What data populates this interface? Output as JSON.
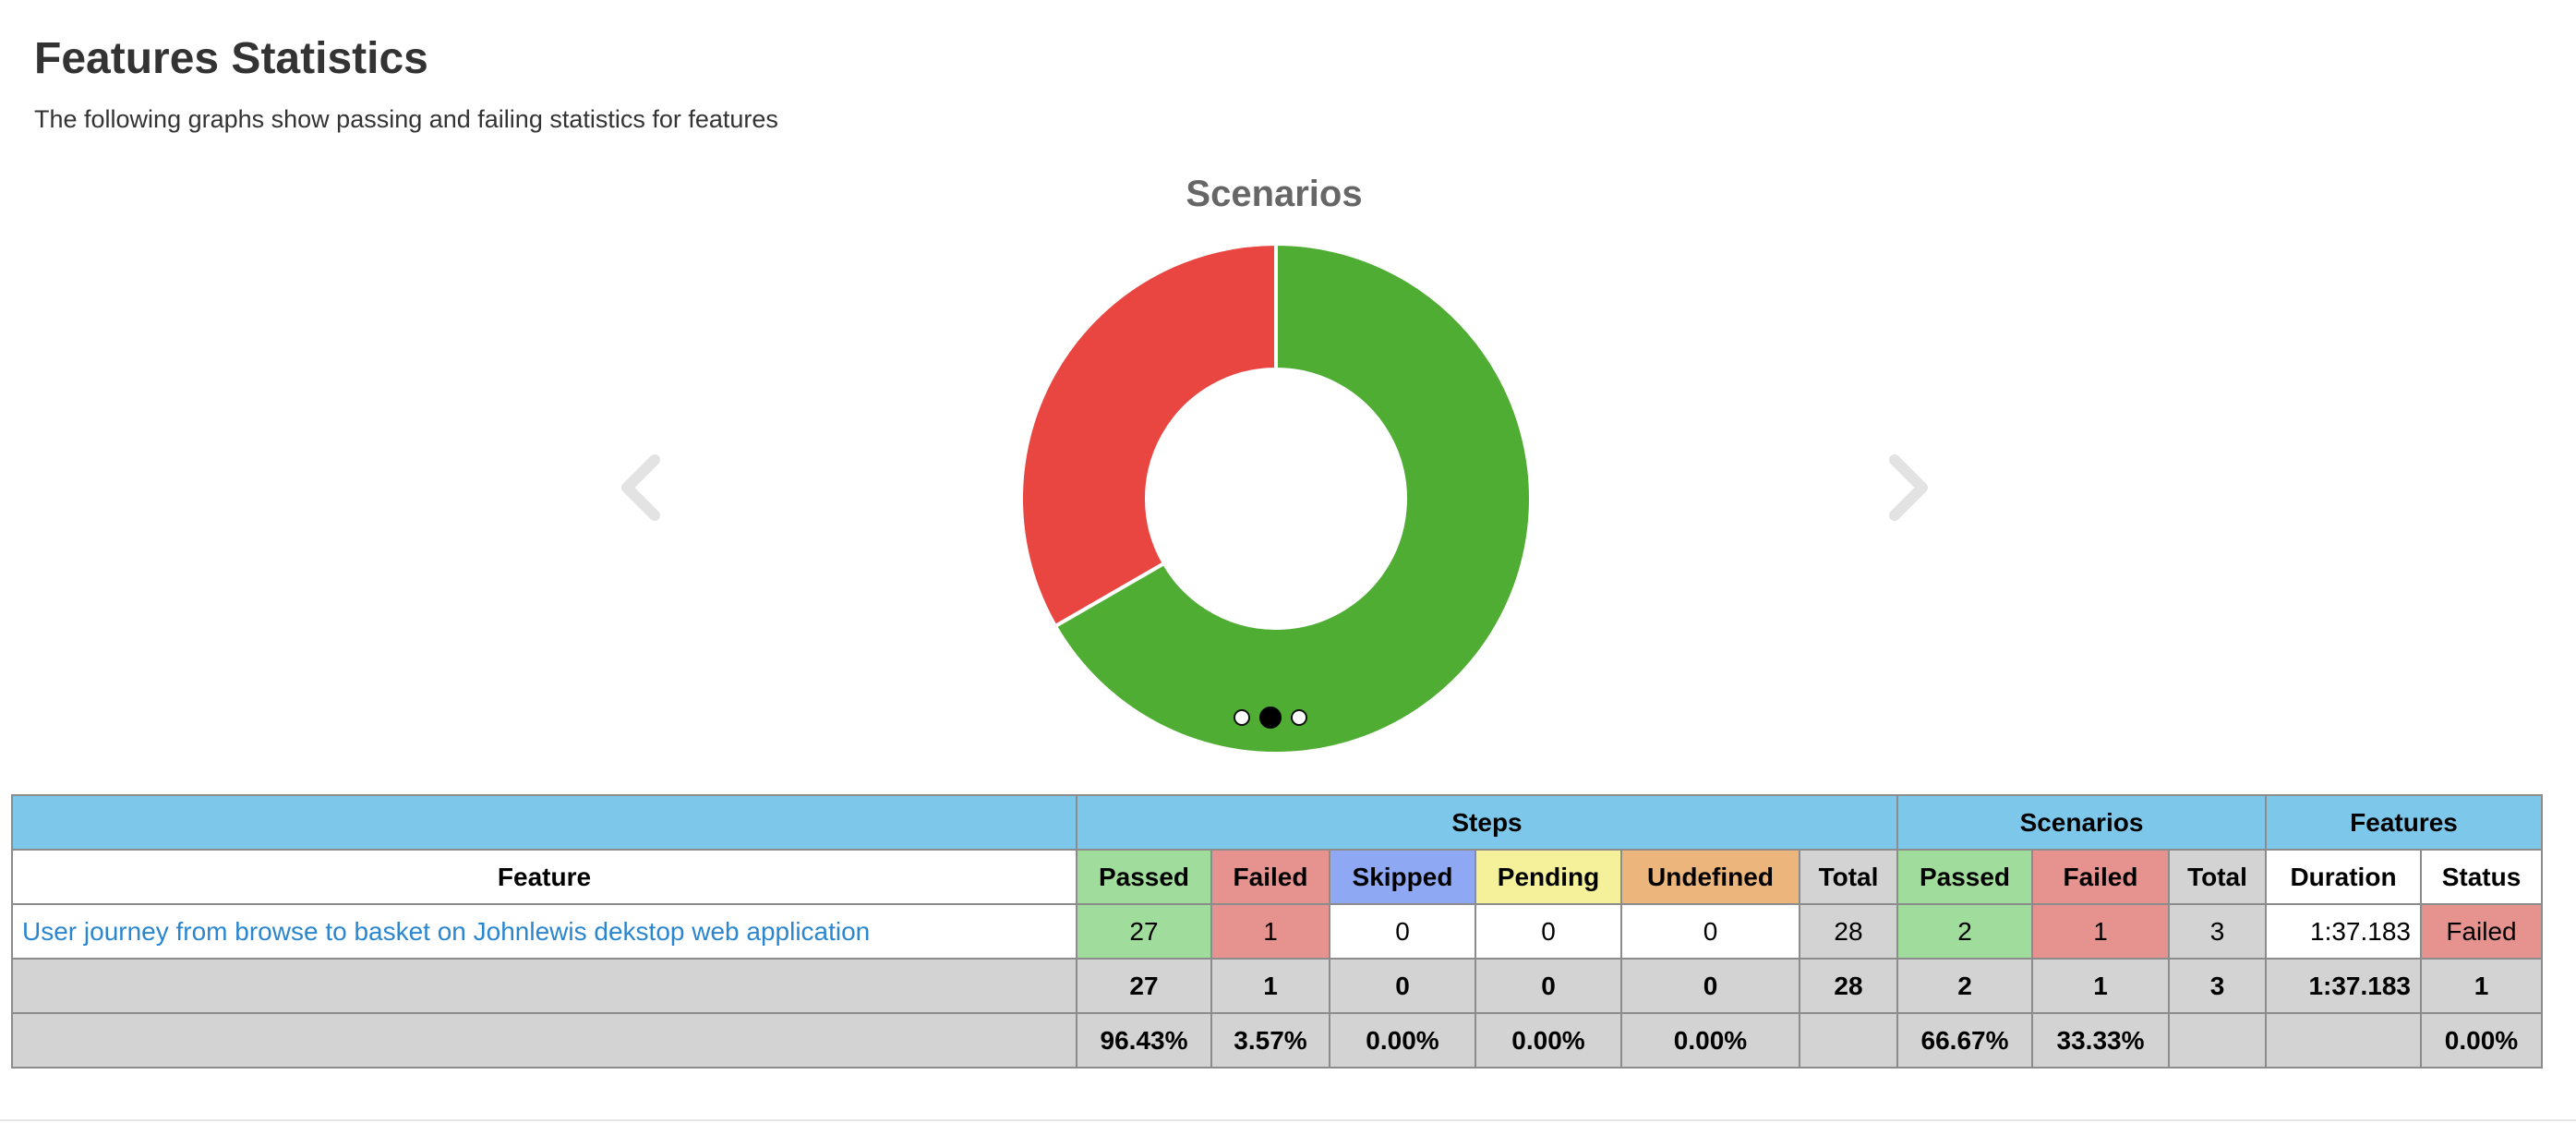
{
  "page": {
    "title": "Features Statistics",
    "subtitle": "The following graphs show passing and failing statistics for features"
  },
  "chart_data": {
    "type": "pie",
    "title": "Scenarios",
    "labels": [
      "Passed",
      "Failed"
    ],
    "values": [
      2,
      1
    ],
    "colors": [
      "#4fad33",
      "#ea4641"
    ]
  },
  "carousel": {
    "prev_icon": "chevron-left-icon",
    "next_icon": "chevron-right-icon",
    "slides": 3,
    "active_slide": 1
  },
  "table": {
    "group_headers": {
      "steps": "Steps",
      "scenarios": "Scenarios",
      "features": "Features"
    },
    "column_headers": {
      "feature": "Feature",
      "steps_passed": "Passed",
      "steps_failed": "Failed",
      "steps_skipped": "Skipped",
      "steps_pending": "Pending",
      "steps_undefined": "Undefined",
      "steps_total": "Total",
      "scen_passed": "Passed",
      "scen_failed": "Failed",
      "scen_total": "Total",
      "duration": "Duration",
      "status": "Status"
    },
    "row": {
      "feature": "User journey from browse to basket on Johnlewis dekstop web application",
      "steps_passed": "27",
      "steps_failed": "1",
      "steps_skipped": "0",
      "steps_pending": "0",
      "steps_undefined": "0",
      "steps_total": "28",
      "scen_passed": "2",
      "scen_failed": "1",
      "scen_total": "3",
      "duration": "1:37.183",
      "status": "Failed"
    },
    "totals": {
      "steps_passed": "27",
      "steps_failed": "1",
      "steps_skipped": "0",
      "steps_pending": "0",
      "steps_undefined": "0",
      "steps_total": "28",
      "scen_passed": "2",
      "scen_failed": "1",
      "scen_total": "3",
      "duration": "1:37.183",
      "status": "1"
    },
    "percentages": {
      "steps_passed": "96.43%",
      "steps_failed": "3.57%",
      "steps_skipped": "0.00%",
      "steps_pending": "0.00%",
      "steps_undefined": "0.00%",
      "scen_passed": "66.67%",
      "scen_failed": "33.33%",
      "status": "0.00%"
    }
  }
}
